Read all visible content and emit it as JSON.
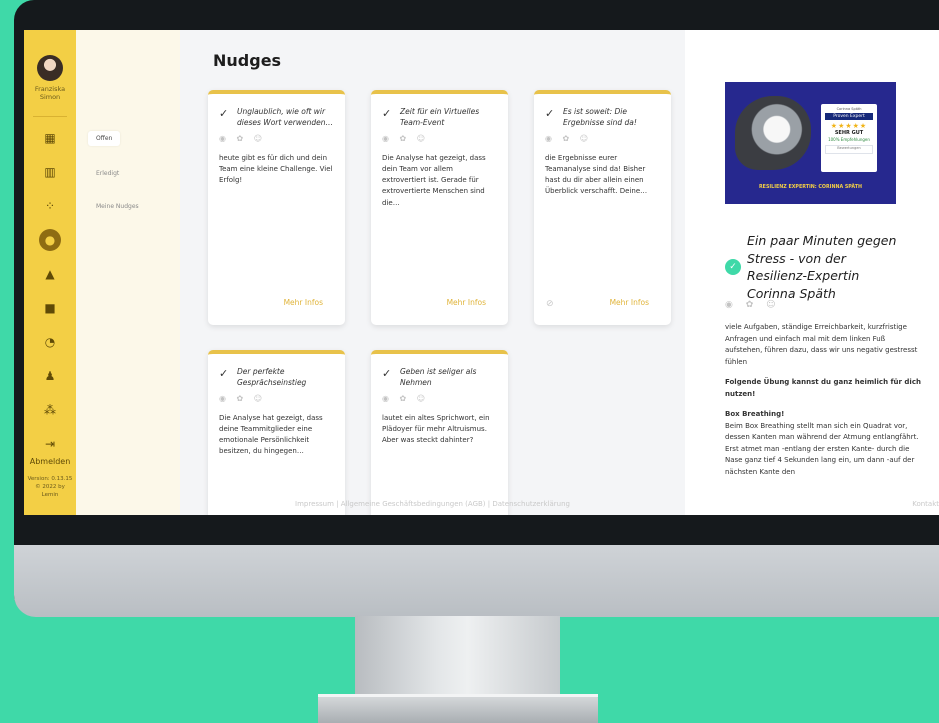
{
  "user": {
    "first_name": "Franziska",
    "last_name": "Simon"
  },
  "rail": {
    "icons": [
      "dashboard-icon",
      "bar-chart-icon",
      "network-icon",
      "lightbulb-icon",
      "graduation-cap-icon",
      "chat-icon",
      "gauge-icon",
      "person-icon",
      "group-icon",
      "logout-icon"
    ],
    "logout_label": "Abmelden",
    "version_line1": "Version: 0.13.15",
    "version_line2": "© 2022 by",
    "version_line3": "Lemin"
  },
  "subnav": {
    "items": [
      "Offen",
      "Erledigt",
      "Meine Nudges"
    ],
    "active": "Offen"
  },
  "main": {
    "title": "Nudges",
    "reactions": "◉ ✿ ☺",
    "more_label": "Mehr Infos",
    "cards": [
      {
        "title": "Unglaublich, wie oft wir dieses Wort verwenden…",
        "body": "heute gibt es für dich und dein Team eine kleine Challenge. Viel Erfolg!"
      },
      {
        "title": "Zeit für ein Virtuelles Team-Event",
        "body": "Die Analyse hat gezeigt, dass dein Team vor allem extrovertiert ist. Gerade für extrovertierte Menschen sind die…"
      },
      {
        "title": "Es ist soweit: Die Ergebnisse sind da!",
        "body": "die Ergebnisse eurer Teamanalyse sind da! Bisher hast du dir aber allein einen Überblick verschafft. Deine…"
      },
      {
        "title": "Der perfekte Gesprächseinstieg",
        "body": "Die Analyse hat gezeigt, dass deine Teammitglieder eine emotionale Persönlichkeit besitzen, du hingegen…"
      },
      {
        "title": "Geben ist seliger als Nehmen",
        "body": "lautet ein altes Sprichwort, ein Plädoyer für mehr Altruismus. Aber was steckt dahinter?"
      }
    ]
  },
  "footer": {
    "links": "Impressum | Allgemeine Geschäftsbedingungen (AGB) | Datenschutzerklärung",
    "contact": "Kontakt"
  },
  "panel": {
    "banner": {
      "badge_name": "Corinna Späth",
      "badge_brand": "Proven Expert",
      "badge_stars": "★★★★★",
      "badge_rating": "SEHR GUT",
      "badge_reco": "100% Empfehlungen",
      "badge_footer": "Bewertungen",
      "caption": "RESILIENZ EXPERTIN: CORINNA SPÄTH"
    },
    "title": "Ein paar Minuten gegen Stress - von der Resilienz-Expertin Corinna Späth",
    "reactions": "◉ ✿ ☺",
    "intro": "viele Aufgaben, ständige Erreichbarkeit, kurzfristige Anfragen und einfach mal mit dem linken Fuß aufstehen, führen dazu, dass wir uns negativ gestresst fühlen",
    "subheading": "Folgende Übung kannst du ganz heimlich für dich nutzen!",
    "exercise_title": "Box Breathing!",
    "exercise_body": "Beim Box Breathing stellt man sich ein Quadrat vor, dessen Kanten man während der Atmung entlangfährt.",
    "exercise_step": "Erst atmet man -entlang der ersten Kante- durch die Nase ganz tief 4 Sekunden lang ein, um dann -auf der nächsten Kante den"
  }
}
